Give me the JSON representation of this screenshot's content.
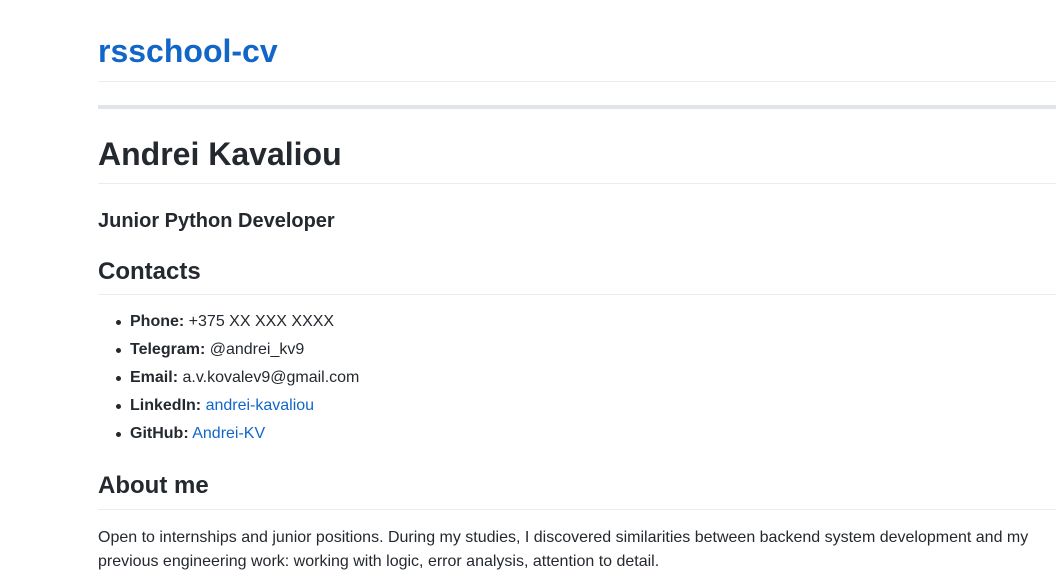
{
  "site": {
    "title": "rsschool-cv"
  },
  "profile": {
    "name": "Andrei Kavaliou",
    "role": "Junior Python Developer"
  },
  "contacts": {
    "title": "Contacts",
    "phone": {
      "label": "Phone:",
      "value": "+375 XX XXX XXXX"
    },
    "telegram": {
      "label": "Telegram:",
      "value": "@andrei_kv9"
    },
    "email": {
      "label": "Email:",
      "value": "a.v.kovalev9@gmail.com"
    },
    "linkedin": {
      "label": "LinkedIn:",
      "value": "andrei-kavaliou"
    },
    "github": {
      "label": "GitHub:",
      "value": "Andrei-KV"
    }
  },
  "about": {
    "title": "About me",
    "text": "Open to internships and junior positions. During my studies, I discovered similarities between backend system development and my previous engineering work: working with logic, error analysis, attention to detail."
  },
  "colors": {
    "link": "#1266c8",
    "text": "#24292f",
    "divider": "#eaecef"
  }
}
